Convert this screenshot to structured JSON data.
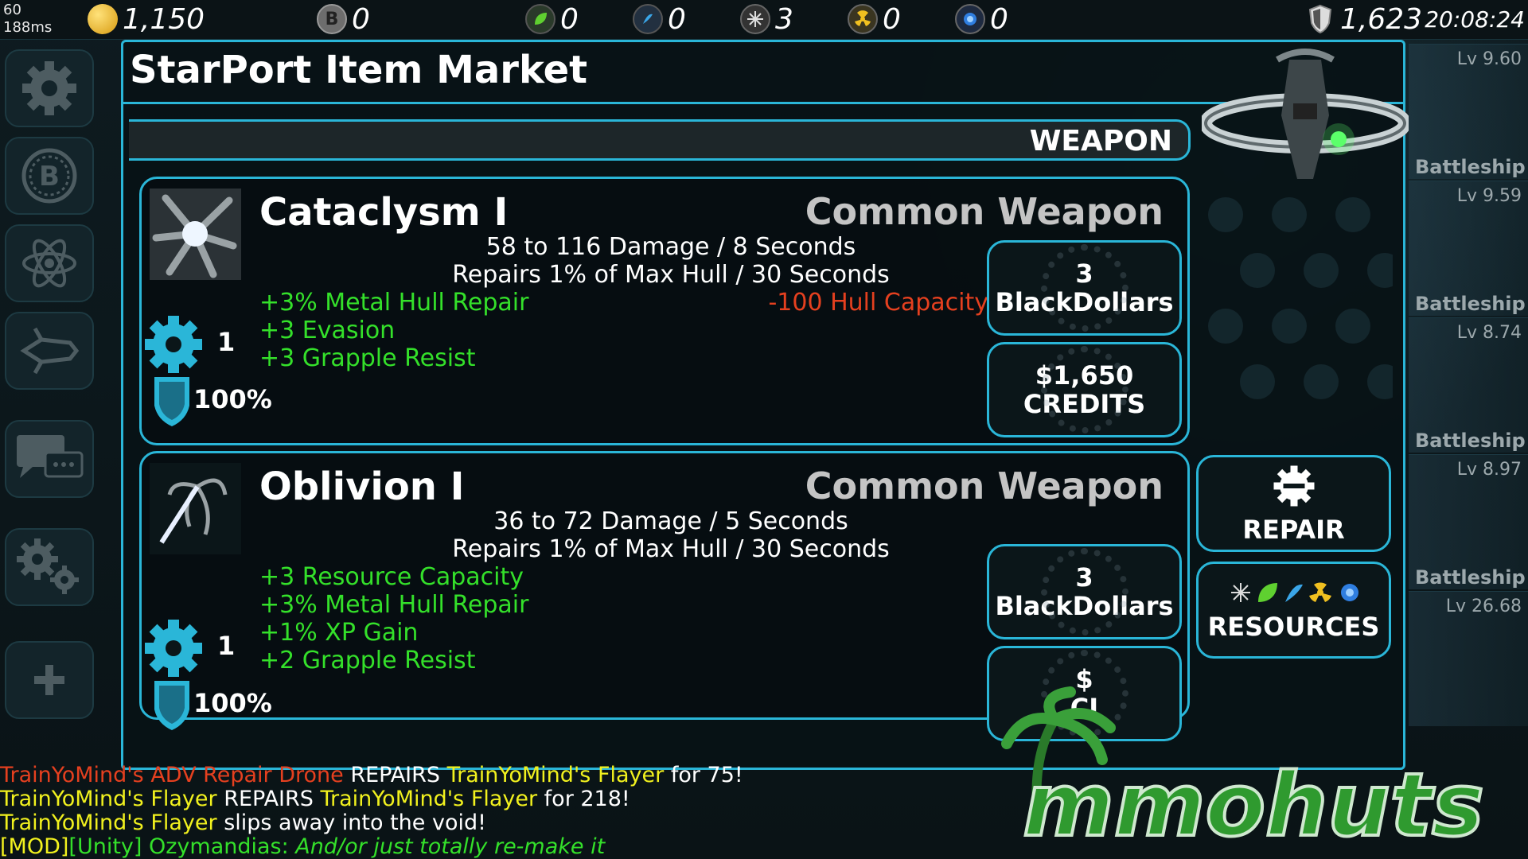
{
  "status": {
    "fps": "60",
    "ping": "188ms",
    "time": "20:08:24"
  },
  "resources": [
    {
      "icon": "gold-coin-icon",
      "value": "1,150"
    },
    {
      "icon": "blackdollar-icon",
      "value": "0"
    },
    {
      "icon": "leaf-icon",
      "value": "0"
    },
    {
      "icon": "water-icon",
      "value": "0"
    },
    {
      "icon": "metal-icon",
      "value": "3"
    },
    {
      "icon": "radioactive-icon",
      "value": "0"
    },
    {
      "icon": "crystal-icon",
      "value": "0"
    },
    {
      "icon": "shield-icon",
      "value": "1,623"
    }
  ],
  "window": {
    "title": "StarPort Item Market",
    "category": "WEAPON"
  },
  "items": [
    {
      "name": "Cataclysm I",
      "rarity": "Common Weapon",
      "stats": [
        "58 to 116 Damage / 8 Seconds",
        "Repairs 1% of Max Hull / 30 Seconds"
      ],
      "bonuses": [
        "+3% Metal Hull Repair",
        "+3 Evasion",
        "+3 Grapple Resist"
      ],
      "penalty": "-100 Hull Capacity",
      "gear_count": "1",
      "condition": "100%",
      "price_bd": [
        "3",
        "BlackDollars"
      ],
      "price_credits": [
        "$1,650",
        "CREDITS"
      ]
    },
    {
      "name": "Oblivion I",
      "rarity": "Common Weapon",
      "stats": [
        "36 to 72 Damage / 5 Seconds",
        "Repairs 1% of Max Hull / 30 Seconds"
      ],
      "bonuses": [
        "+3 Resource Capacity",
        "+3% Metal Hull Repair",
        "+1% XP Gain",
        "+2 Grapple Resist"
      ],
      "gear_count": "1",
      "condition": "100%",
      "price_bd": [
        "3",
        "BlackDollars"
      ],
      "price_credits": [
        "$",
        "CI"
      ]
    }
  ],
  "actions": {
    "repair": "REPAIR",
    "resources": "RESOURCES"
  },
  "right_list": [
    {
      "level": "Lv 9.60",
      "name": ""
    },
    {
      "level": "Lv 9.59",
      "name": "Battleship"
    },
    {
      "level": "Lv 8.74",
      "name": "Battleship"
    },
    {
      "level": "Lv 8.97",
      "name": "Battleship"
    },
    {
      "level": "Lv 26.68",
      "name": "Battleship"
    }
  ],
  "chat": [
    {
      "parts": [
        {
          "t": "TrainYoMind's ADV Repair Drone",
          "c": "red"
        },
        {
          "t": " REPAIRS ",
          "c": "wht"
        },
        {
          "t": "TrainYoMind's Flayer",
          "c": "yel"
        },
        {
          "t": " for 75!",
          "c": "wht"
        }
      ]
    },
    {
      "parts": [
        {
          "t": "TrainYoMind's Flayer",
          "c": "yel"
        },
        {
          "t": " REPAIRS ",
          "c": "wht"
        },
        {
          "t": "TrainYoMind's Flayer",
          "c": "yel"
        },
        {
          "t": " for 218!",
          "c": "wht"
        }
      ]
    },
    {
      "parts": [
        {
          "t": "TrainYoMind's Flayer",
          "c": "yel"
        },
        {
          "t": " slips away into the void!",
          "c": "wht"
        }
      ]
    },
    {
      "parts": [
        {
          "t": "[MOD]",
          "c": "yel"
        },
        {
          "t": "[Unity] Ozymandias: ",
          "c": "grn"
        },
        {
          "t": "And/or just totally re-make it",
          "c": "grn it"
        }
      ]
    }
  ],
  "watermark": "mmohuts"
}
